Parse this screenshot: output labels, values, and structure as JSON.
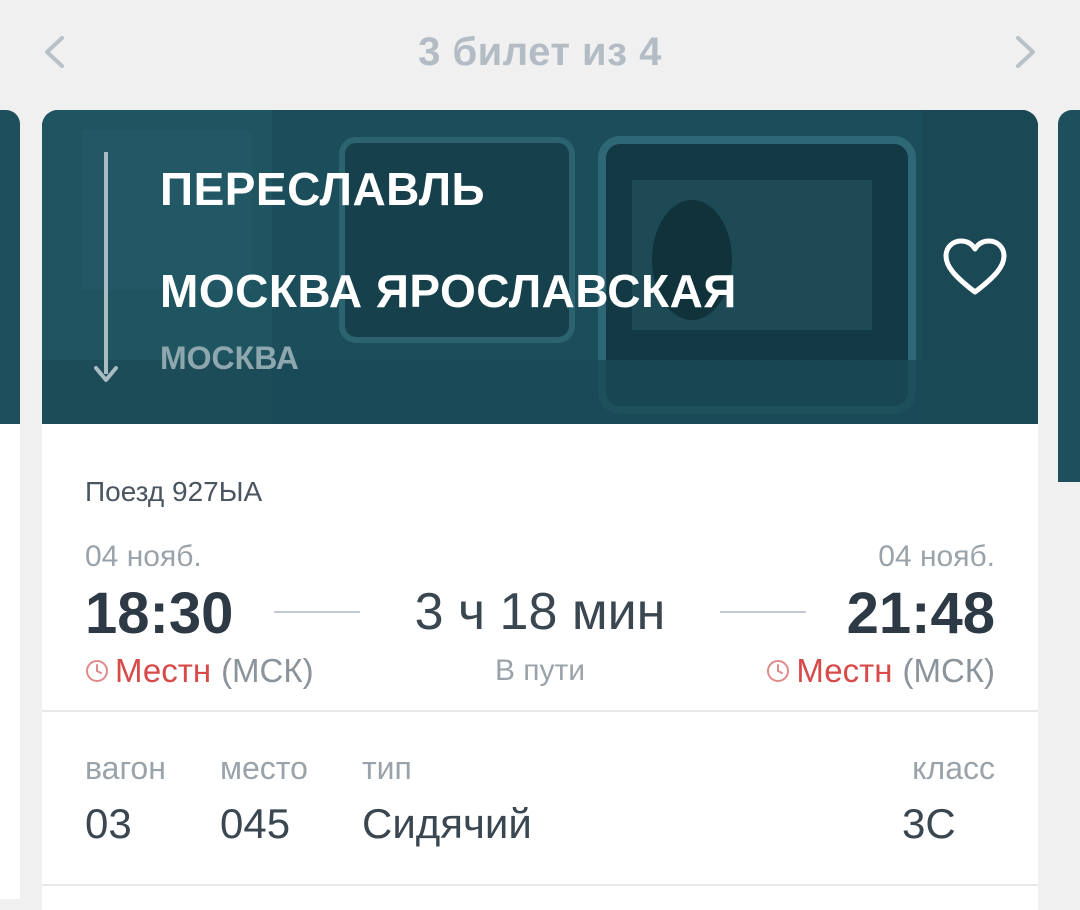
{
  "header": {
    "counter": "3 билет из 4",
    "prev_icon": "chevron-left-icon",
    "next_icon": "chevron-right-icon"
  },
  "route": {
    "from": "ПЕРЕСЛАВЛЬ",
    "to": "МОСКВА ЯРОСЛАВСКАЯ",
    "to_city": "МОСКВА",
    "favorite_icon": "heart-outline-icon"
  },
  "trip": {
    "train": "Поезд 927ЫА",
    "departure": {
      "date": "04 нояб.",
      "time": "18:30",
      "local": "Местн",
      "zone": "(МСК)"
    },
    "arrival": {
      "date": "04 нояб.",
      "time": "21:48",
      "local": "Местн",
      "zone": "(МСК)"
    },
    "duration": "3 ч 18 мин",
    "en_route": "В пути"
  },
  "seat": {
    "car_label": "вагон",
    "car_value": "03",
    "seat_label": "место",
    "seat_value": "045",
    "type_label": "тип",
    "type_value": "Сидячий",
    "class_label": "класс",
    "class_value": "3С"
  },
  "colors": {
    "hero_bg": "#1c4d5a",
    "local_time_red": "#d84a4a",
    "counter_gray": "#b3bbc4"
  }
}
